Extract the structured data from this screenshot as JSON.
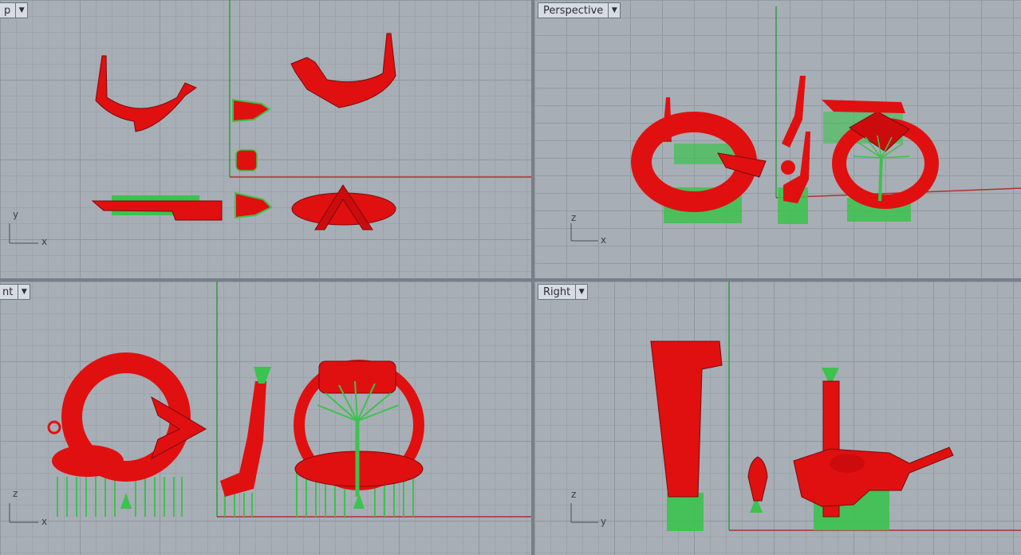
{
  "viewports": {
    "top": {
      "label": "p",
      "axis_v": "y",
      "axis_h": "x"
    },
    "persp": {
      "label": "Perspective",
      "axis_v": "z",
      "axis_h": "x"
    },
    "front": {
      "label": "nt",
      "axis_v": "z",
      "axis_h": "x"
    },
    "right": {
      "label": "Right",
      "axis_v": "z",
      "axis_h": "y"
    }
  },
  "dropdown_glyph": "▼",
  "colors": {
    "model": "#e01010",
    "support": "#3cc24e",
    "x_axis": "#b23030",
    "y_axis": "#2f9e3e"
  }
}
